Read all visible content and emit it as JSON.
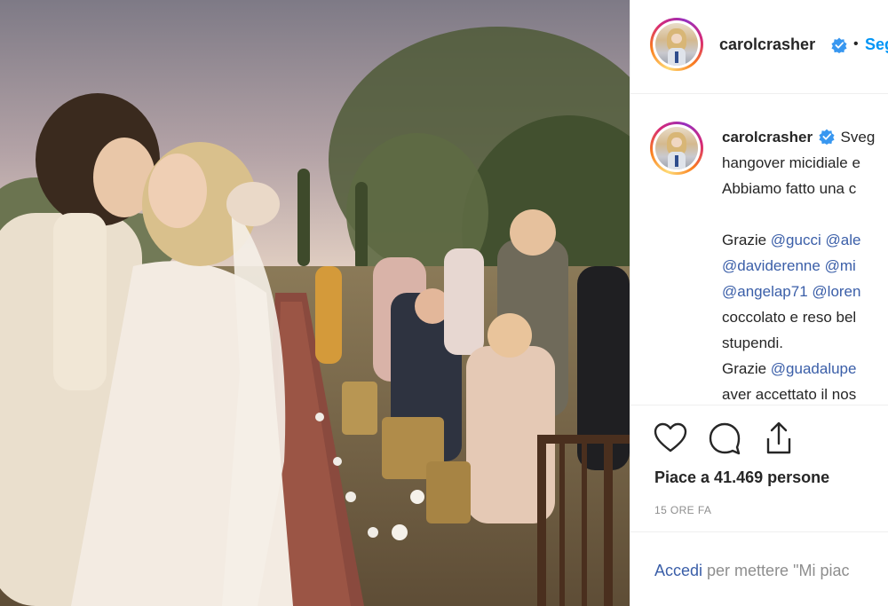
{
  "post": {
    "username": "carolcrasher",
    "separator": "•",
    "follow_label": "Seg",
    "caption": {
      "username": "carolcrasher",
      "line1": "Sveg",
      "line2": "hangover micidiale e",
      "line3": "Abbiamo fatto una c",
      "line4_prefix": "Grazie ",
      "line4_m1": "@gucci",
      "line4_m2": "@ale",
      "line5_m1": "@daviderenne",
      "line5_m2": "@mi",
      "line6_m1": "@angelap71",
      "line6_m2": "@loren",
      "line7": "coccolato e reso bel",
      "line8": "stupendi.",
      "line9_prefix": "Grazie ",
      "line9_m1": "@guadalupe",
      "line10": "aver accettato il nos"
    },
    "likes_text": "Piace a 41.469 persone",
    "timestamp": "15 ORE FA",
    "login": {
      "link": "Accedi",
      "rest": " per mettere \"Mi piac"
    }
  },
  "icons": {
    "verified": "verified-badge-icon",
    "like": "heart-icon",
    "comment": "comment-bubble-icon",
    "share": "share-icon"
  },
  "colors": {
    "link": "#3a5ea8",
    "follow": "#0095f6",
    "verified": "#3897f0",
    "muted": "#8e8e8e"
  }
}
